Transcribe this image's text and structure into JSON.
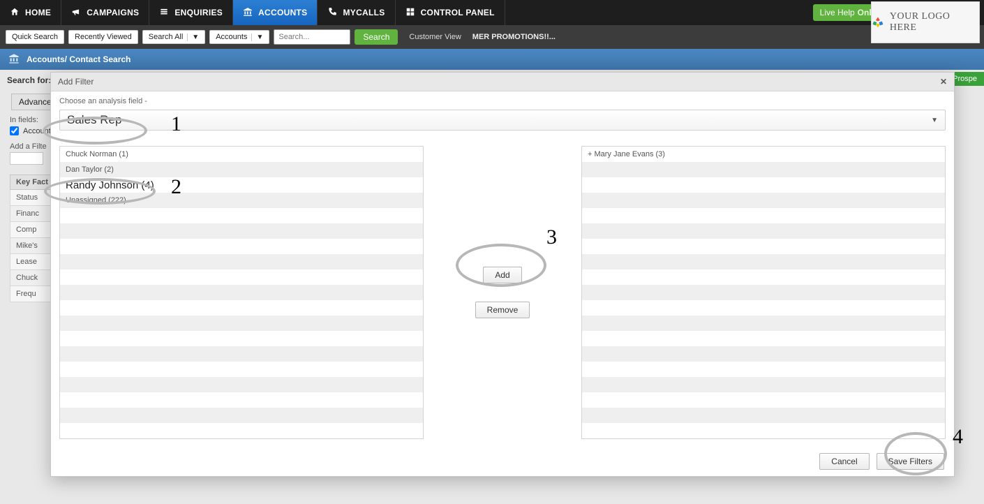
{
  "nav": {
    "home": "HOME",
    "campaigns": "CAMPAIGNS",
    "enquiries": "ENQUIRIES",
    "accounts": "ACCOUNTS",
    "mycalls": "MYCALLS",
    "control_panel": "CONTROL PANEL"
  },
  "live_help": {
    "label": "Live Help",
    "status": "Online"
  },
  "searchbar": {
    "quick_search": "Quick Search",
    "recently_viewed": "Recently Viewed",
    "search_all": "Search All",
    "accounts": "Accounts",
    "placeholder": "Search...",
    "search_btn": "Search",
    "customer_view": "Customer View",
    "mer": "MER PROMOTIONS!!..."
  },
  "bluebar": {
    "title": "Accounts/ Contact Search"
  },
  "logo_text": "YOUR LOGO HERE",
  "left": {
    "search_for": "Search for:",
    "advanced": "Advanced :",
    "in_fields": "In fields:",
    "account": "Account",
    "add_filter": "Add a Filte",
    "key_facts": "Key Fact",
    "rows": [
      "Status",
      "Financ",
      "Comp",
      "Mike's",
      "Lease",
      "Chuck",
      "Frequ"
    ]
  },
  "new_prospect": "w Prospe",
  "modal": {
    "title": "Add Filter",
    "choose_label": "Choose an analysis field -",
    "field_value": "Sales Rep",
    "left_list": [
      "Chuck Norman (1)",
      "Dan Taylor (2)",
      "Randy Johnson (4)",
      "Unassigned (222)"
    ],
    "right_list": [
      "+ Mary Jane Evans (3)"
    ],
    "add": "Add",
    "remove": "Remove",
    "cancel": "Cancel",
    "save": "Save Filters"
  },
  "annotations": {
    "n1": "1",
    "n2": "2",
    "n3": "3",
    "n4": "4"
  }
}
